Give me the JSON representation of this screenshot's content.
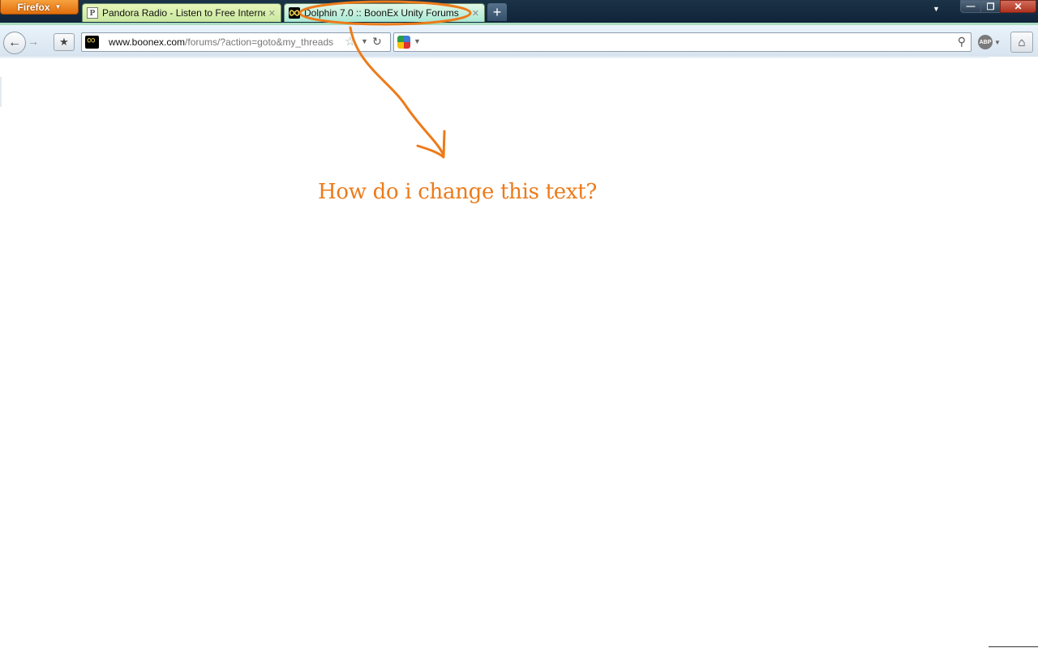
{
  "browser": {
    "menu_button_label": "Firefox",
    "tabs": [
      {
        "title": "Pandora Radio - Listen to Free Interne...",
        "favicon": "P",
        "active": false
      },
      {
        "title": "Dolphin 7.0 :: BoonEx Unity Forums",
        "favicon": "boonex-infinity-icon",
        "active": true
      }
    ],
    "new_tab_label": "+",
    "window_controls": {
      "minimize": "—",
      "maximize": "❐",
      "close": "✕"
    }
  },
  "navbar": {
    "url_domain": "www.boonex.com",
    "url_path": "/forums/?action=goto&my_threads",
    "search_value": "",
    "back_icon": "←",
    "forward_icon": "→",
    "reload_icon": "↻",
    "home_icon": "⌂",
    "abp_label": "ABP"
  },
  "annotation": {
    "text": "How do i change this text?",
    "color": "#ec7b1a"
  }
}
